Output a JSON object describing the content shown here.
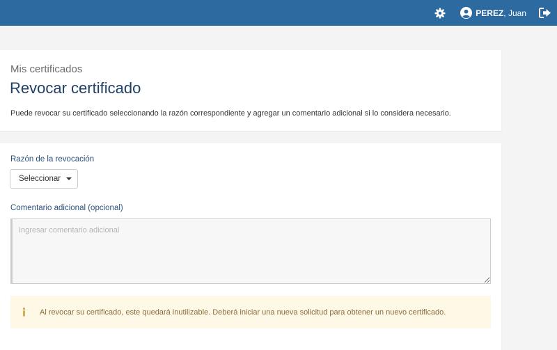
{
  "header": {
    "user_last_name": "PEREZ",
    "user_first_name": ", Juan",
    "icons": [
      "gear-icon",
      "user-circle-icon",
      "sign-out-icon"
    ],
    "background_color": "#2c6aa0"
  },
  "page": {
    "breadcrumb": "Mis certificados",
    "title": "Revocar certificado",
    "description": "Puede revocar su certificado seleccionando la razón correspondiente y agregar un comentario adicional si lo considera necesario."
  },
  "form": {
    "reason_label": "Razón de la revocación",
    "reason_select": "Seleccionar",
    "comment_label": "Comentario adicional (opcional)",
    "comment_placeholder": "Ingresar comentario adicional",
    "comment_value": ""
  },
  "alert": {
    "icon": "info-icon",
    "message": "Al revocar su certificado, este quedará inutilizable. Deberá iniciar una nueva solicitud para obtener un nuevo certificado.",
    "color": "#8a6d3b",
    "background": "#fdf9e6"
  }
}
